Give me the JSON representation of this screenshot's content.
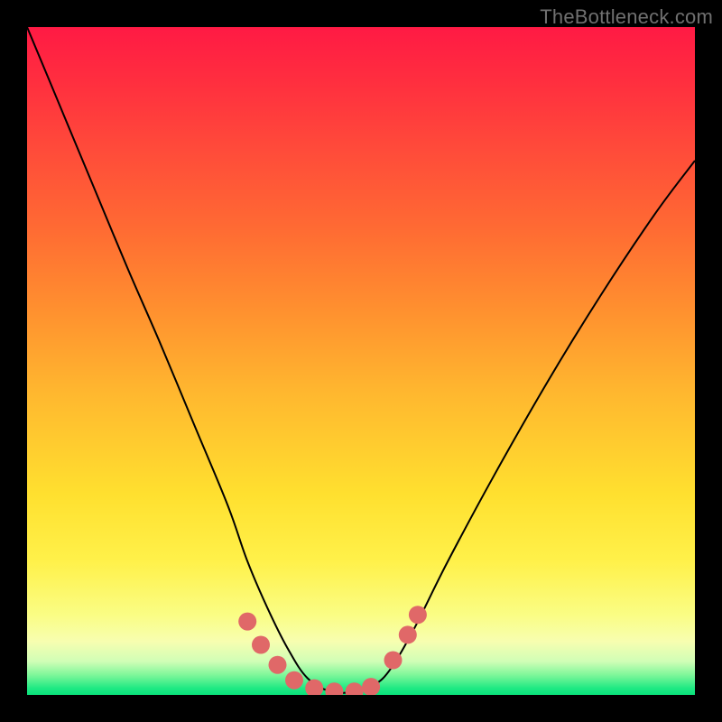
{
  "watermark": "TheBottleneck.com",
  "colors": {
    "background": "#000000",
    "gradient_top": "#ff1a44",
    "gradient_mid": "#ffe02f",
    "gradient_bottom": "#09e27b",
    "curve": "#000000",
    "marker": "#e06868",
    "watermark_text": "#707070"
  },
  "chart_data": {
    "type": "line",
    "title": "",
    "xlabel": "",
    "ylabel": "",
    "xlim": [
      0,
      1
    ],
    "ylim": [
      0,
      1
    ],
    "note": "Axes are unlabelled; x and y are normalized 0–1 over the plot area. The curve is a V-shaped bottleneck profile with a rounded minimum plateau.",
    "series": [
      {
        "name": "bottleneck-curve",
        "x": [
          0.0,
          0.05,
          0.1,
          0.15,
          0.2,
          0.25,
          0.3,
          0.33,
          0.36,
          0.39,
          0.42,
          0.455,
          0.49,
          0.52,
          0.545,
          0.58,
          0.63,
          0.7,
          0.78,
          0.86,
          0.94,
          1.0
        ],
        "y": [
          1.0,
          0.88,
          0.76,
          0.64,
          0.525,
          0.405,
          0.285,
          0.2,
          0.13,
          0.07,
          0.025,
          0.005,
          0.005,
          0.015,
          0.04,
          0.1,
          0.2,
          0.33,
          0.47,
          0.6,
          0.72,
          0.8
        ]
      }
    ],
    "markers": {
      "name": "highlight-band",
      "points": [
        {
          "x": 0.33,
          "y": 0.11
        },
        {
          "x": 0.35,
          "y": 0.075
        },
        {
          "x": 0.375,
          "y": 0.045
        },
        {
          "x": 0.4,
          "y": 0.022
        },
        {
          "x": 0.43,
          "y": 0.01
        },
        {
          "x": 0.46,
          "y": 0.005
        },
        {
          "x": 0.49,
          "y": 0.005
        },
        {
          "x": 0.515,
          "y": 0.012
        },
        {
          "x": 0.548,
          "y": 0.052
        },
        {
          "x": 0.57,
          "y": 0.09
        },
        {
          "x": 0.585,
          "y": 0.12
        }
      ]
    }
  }
}
